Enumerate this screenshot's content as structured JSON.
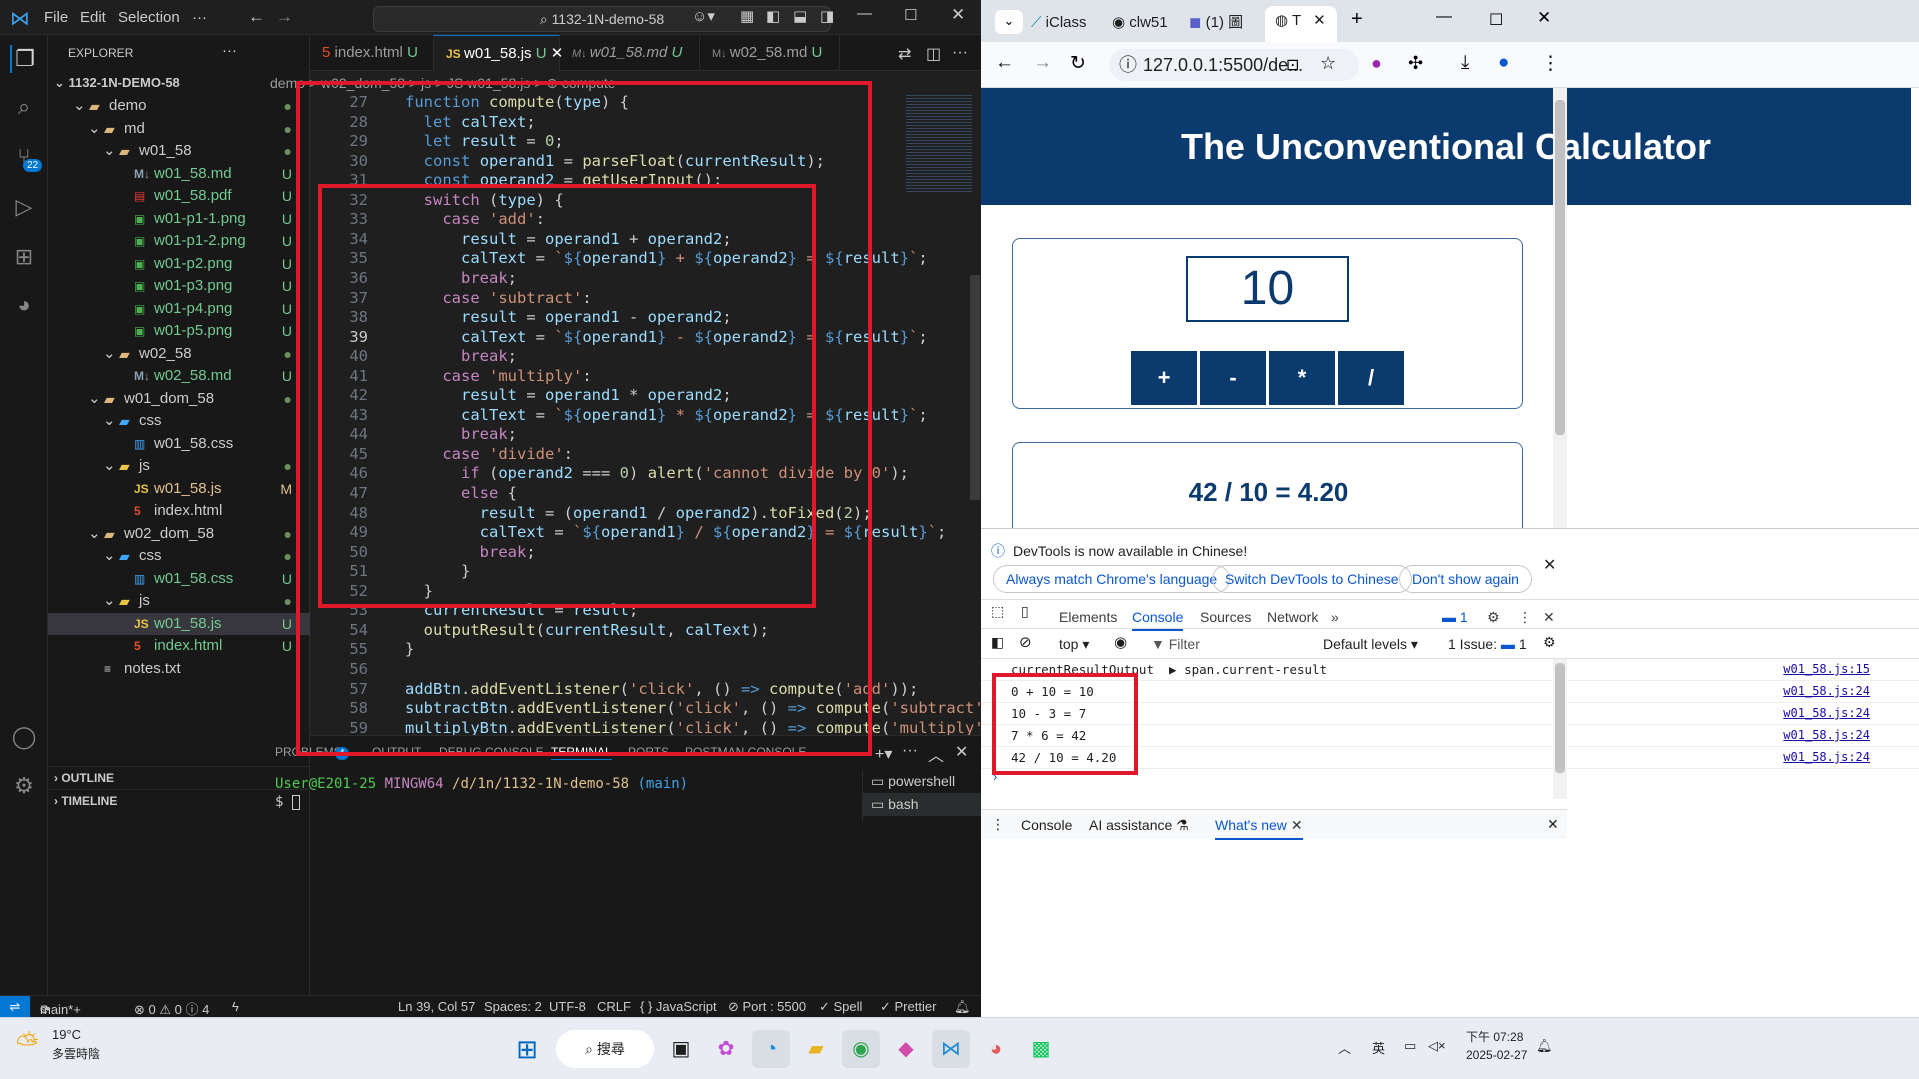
{
  "vscode": {
    "menu": [
      "File",
      "Edit",
      "Selection",
      "···"
    ],
    "command_center": "1132-1N-demo-58",
    "source_control_badge": "22",
    "explorer_title": "EXPLORER",
    "root": "1132-1N-DEMO-58",
    "tree": [
      {
        "label": "demo",
        "kind": "folder",
        "depth": 1,
        "status": "●"
      },
      {
        "label": "md",
        "kind": "folder",
        "depth": 2,
        "status": "●"
      },
      {
        "label": "w01_58",
        "kind": "folder",
        "depth": 3,
        "status": "●"
      },
      {
        "label": "w01_58.md",
        "kind": "md",
        "depth": 4,
        "status": "U"
      },
      {
        "label": "w01_58.pdf",
        "kind": "pdf",
        "depth": 4,
        "status": "U"
      },
      {
        "label": "w01-p1-1.png",
        "kind": "img",
        "depth": 4,
        "status": "U"
      },
      {
        "label": "w01-p1-2.png",
        "kind": "img",
        "depth": 4,
        "status": "U"
      },
      {
        "label": "w01-p2.png",
        "kind": "img",
        "depth": 4,
        "status": "U"
      },
      {
        "label": "w01-p3.png",
        "kind": "img",
        "depth": 4,
        "status": "U"
      },
      {
        "label": "w01-p4.png",
        "kind": "img",
        "depth": 4,
        "status": "U"
      },
      {
        "label": "w01-p5.png",
        "kind": "img",
        "depth": 4,
        "status": "U"
      },
      {
        "label": "w02_58",
        "kind": "folder",
        "depth": 3,
        "status": "●"
      },
      {
        "label": "w02_58.md",
        "kind": "md",
        "depth": 4,
        "status": "U"
      },
      {
        "label": "w01_dom_58",
        "kind": "folder",
        "depth": 2,
        "status": "●"
      },
      {
        "label": "css",
        "kind": "cssfolder",
        "depth": 3,
        "status": ""
      },
      {
        "label": "w01_58.css",
        "kind": "css",
        "depth": 4,
        "status": ""
      },
      {
        "label": "js",
        "kind": "jsfolder",
        "depth": 3,
        "status": "●"
      },
      {
        "label": "w01_58.js",
        "kind": "js",
        "depth": 4,
        "status": "M"
      },
      {
        "label": "index.html",
        "kind": "html",
        "depth": 4,
        "status": ""
      },
      {
        "label": "w02_dom_58",
        "kind": "folder",
        "depth": 2,
        "status": "●"
      },
      {
        "label": "css",
        "kind": "cssfolder",
        "depth": 3,
        "status": "●"
      },
      {
        "label": "w01_58.css",
        "kind": "css",
        "depth": 4,
        "status": "U"
      },
      {
        "label": "js",
        "kind": "jsfolder",
        "depth": 3,
        "status": "●"
      },
      {
        "label": "w01_58.js",
        "kind": "js",
        "depth": 4,
        "status": "U"
      },
      {
        "label": "index.html",
        "kind": "html",
        "depth": 4,
        "status": "U"
      },
      {
        "label": "notes.txt",
        "kind": "txt",
        "depth": 2,
        "status": ""
      }
    ],
    "outline": "OUTLINE",
    "timeline": "TIMELINE",
    "tabs": [
      {
        "label": "index.html",
        "status": "U"
      },
      {
        "label": "w01_58.js",
        "status": "U"
      },
      {
        "label": "w01_58.md",
        "status": "U"
      },
      {
        "label": "w02_58.md",
        "status": "U"
      }
    ],
    "breadcrumb": "demo > w02_dom_58 > js > JS w01_58.js > ⊕ compute",
    "code_lines": [
      {
        "n": "27",
        "html": "<span class='kw'>function</span> <span class='fn'>compute</span>(<span class='var'>type</span>) {"
      },
      {
        "n": "28",
        "html": "  <span class='kw'>let</span> <span class='var'>calText</span>;"
      },
      {
        "n": "29",
        "html": "  <span class='kw'>let</span> <span class='var'>result</span> = <span class='num'>0</span>;"
      },
      {
        "n": "30",
        "html": "  <span class='kw'>const</span> <span class='var'>operand1</span> = <span class='fn'>parseFloat</span>(<span class='var'>currentResult</span>);"
      },
      {
        "n": "31",
        "html": "  <span class='kw'>const</span> <span class='var'>operand2</span> = <span class='fn'>getUserInput</span>();"
      },
      {
        "n": "32",
        "html": "  <span class='ctl'>switch</span> (<span class='var'>type</span>) {"
      },
      {
        "n": "33",
        "html": "    <span class='ctl'>case</span> <span class='str'>'add'</span>:"
      },
      {
        "n": "34",
        "html": "      <span class='var'>result</span> = <span class='var'>operand1</span> + <span class='var'>operand2</span>;"
      },
      {
        "n": "35",
        "html": "      <span class='var'>calText</span> = <span class='tpl'>`</span><span class='kw'>${</span><span class='var'>operand1</span><span class='kw'>}</span><span class='tpl'> + </span><span class='kw'>${</span><span class='var'>operand2</span><span class='kw'>}</span><span class='tpl'> = </span><span class='kw'>${</span><span class='var'>result</span><span class='kw'>}</span><span class='tpl'>`</span>;"
      },
      {
        "n": "36",
        "html": "      <span class='ctl'>break</span>;"
      },
      {
        "n": "37",
        "html": "    <span class='ctl'>case</span> <span class='str'>'subtract'</span>:"
      },
      {
        "n": "38",
        "html": "      <span class='var'>result</span> = <span class='var'>operand1</span> - <span class='var'>operand2</span>;"
      },
      {
        "n": "39",
        "html": "      <span class='var'>calText</span> = <span class='tpl'>`</span><span class='kw'>${</span><span class='var'>operand1</span><span class='kw'>}</span><span class='tpl'> - </span><span class='kw'>${</span><span class='var'>operand2</span><span class='kw'>}</span><span class='tpl'> = </span><span class='kw'>${</span><span class='var'>result</span><span class='kw'>}</span><span class='tpl'>`</span>;"
      },
      {
        "n": "40",
        "html": "      <span class='ctl'>break</span>;"
      },
      {
        "n": "41",
        "html": "    <span class='ctl'>case</span> <span class='str'>'multiply'</span>:"
      },
      {
        "n": "42",
        "html": "      <span class='var'>result</span> = <span class='var'>operand1</span> * <span class='var'>operand2</span>;"
      },
      {
        "n": "43",
        "html": "      <span class='var'>calText</span> = <span class='tpl'>`</span><span class='kw'>${</span><span class='var'>operand1</span><span class='kw'>}</span><span class='tpl'> * </span><span class='kw'>${</span><span class='var'>operand2</span><span class='kw'>}</span><span class='tpl'> = </span><span class='kw'>${</span><span class='var'>result</span><span class='kw'>}</span><span class='tpl'>`</span>;"
      },
      {
        "n": "44",
        "html": "      <span class='ctl'>break</span>;"
      },
      {
        "n": "45",
        "html": "    <span class='ctl'>case</span> <span class='str'>'divide'</span>:"
      },
      {
        "n": "46",
        "html": "      <span class='ctl'>if</span> (<span class='var'>operand2</span> === <span class='num'>0</span>) <span class='fn'>alert</span>(<span class='str'>'cannot divide by 0'</span>);"
      },
      {
        "n": "47",
        "html": "      <span class='ctl'>else</span> {"
      },
      {
        "n": "48",
        "html": "        <span class='var'>result</span> = (<span class='var'>operand1</span> / <span class='var'>operand2</span>).<span class='fn'>toFixed</span>(<span class='num'>2</span>);"
      },
      {
        "n": "49",
        "html": "        <span class='var'>calText</span> = <span class='tpl'>`</span><span class='kw'>${</span><span class='var'>operand1</span><span class='kw'>}</span><span class='tpl'> / </span><span class='kw'>${</span><span class='var'>operand2</span><span class='kw'>}</span><span class='tpl'> = </span><span class='kw'>${</span><span class='var'>result</span><span class='kw'>}</span><span class='tpl'>`</span>;"
      },
      {
        "n": "50",
        "html": "        <span class='ctl'>break</span>;"
      },
      {
        "n": "51",
        "html": "      }"
      },
      {
        "n": "52",
        "html": "  }"
      },
      {
        "n": "53",
        "html": "  <span class='var'>currentResult</span> = <span class='var'>result</span>;"
      },
      {
        "n": "54",
        "html": "  <span class='fn'>outputResult</span>(<span class='var'>currentResult</span>, <span class='var'>calText</span>);"
      },
      {
        "n": "55",
        "html": "}"
      },
      {
        "n": "56",
        "html": ""
      },
      {
        "n": "57",
        "html": "<span class='var'>addBtn</span>.<span class='fn'>addEventListener</span>(<span class='str'>'click'</span>, () <span class='kw'>=&gt;</span> <span class='fn'>compute</span>(<span class='str'>'add'</span>));"
      },
      {
        "n": "58",
        "html": "<span class='var'>subtractBtn</span>.<span class='fn'>addEventListener</span>(<span class='str'>'click'</span>, () <span class='kw'>=&gt;</span> <span class='fn'>compute</span>(<span class='str'>'subtract'</span>));"
      },
      {
        "n": "59",
        "html": "<span class='var'>multiplyBtn</span>.<span class='fn'>addEventListener</span>(<span class='str'>'click'</span>, () <span class='kw'>=&gt;</span> <span class='fn'>compute</span>(<span class='str'>'multiply'</span>));"
      }
    ],
    "panel_tabs": [
      "PROBLEMS",
      "OUTPUT",
      "DEBUG CONSOLE",
      "TERMINAL",
      "PORTS",
      "POSTMAN CONSOLE"
    ],
    "problems_count": "4",
    "terminal_prompt_user": "User@E201-25",
    "terminal_prompt_env": "MINGW64",
    "terminal_prompt_path": "/d/1n/1132-1N-demo-58",
    "terminal_prompt_branch": "(main)",
    "terminal_input": "$",
    "terminal_instances": [
      "powershell",
      "bash"
    ],
    "status": {
      "branch": "main*+",
      "errors": "⊗ 0 ⚠ 0 ⓘ 4",
      "position": "Ln 39, Col 57",
      "spaces": "Spaces: 2",
      "encoding": "UTF-8",
      "eol": "CRLF",
      "language": "{ } JavaScript",
      "port": "⊘ Port : 5500",
      "spell": "✓ Spell",
      "prettier": "✓ Prettier"
    }
  },
  "chrome": {
    "tabs": [
      "iClass",
      "clw51",
      "(1) 圖",
      "T"
    ],
    "url": "127.0.0.1:5500/de...",
    "page_title": "The Unconventional Calculator",
    "input_value": "10",
    "op_buttons": [
      "+",
      "-",
      "*",
      "/"
    ],
    "result_text": "42 / 10 = 4.20",
    "devtools": {
      "notice": "DevTools is now available in Chinese!",
      "pills": [
        "Always match Chrome's language",
        "Switch DevTools to Chinese",
        "Don't show again"
      ],
      "tabs": [
        "Elements",
        "Console",
        "Sources",
        "Network"
      ],
      "msg_badge": "1",
      "filter_context": "top",
      "filter_placeholder": "Filter",
      "levels": "Default levels",
      "issues": "1 Issue:",
      "issues_count": "1",
      "logs": [
        {
          "msg": "currentResultOutput  ▶ span.current-result",
          "src": "w01_58.js:15"
        },
        {
          "msg": "0 + 10 = 10",
          "src": "w01_58.js:24"
        },
        {
          "msg": "10 - 3 = 7",
          "src": "w01_58.js:24"
        },
        {
          "msg": "7 * 6 = 42",
          "src": "w01_58.js:24"
        },
        {
          "msg": "42 / 10 = 4.20",
          "src": "w01_58.js:24"
        }
      ],
      "drawer_tabs": [
        "Console",
        "AI assistance",
        "What's new"
      ]
    }
  },
  "taskbar": {
    "weather_temp": "19°C",
    "weather_desc": "多雲時陰",
    "search_label": "搜尋",
    "ime": "英",
    "time": "下午 07:28",
    "date": "2025-02-27"
  },
  "colors": {
    "accent_blue": "#0078d4",
    "calc_navy": "#0b3a6e",
    "highlight_red": "#e0182a",
    "untracked_green": "#73c991"
  }
}
